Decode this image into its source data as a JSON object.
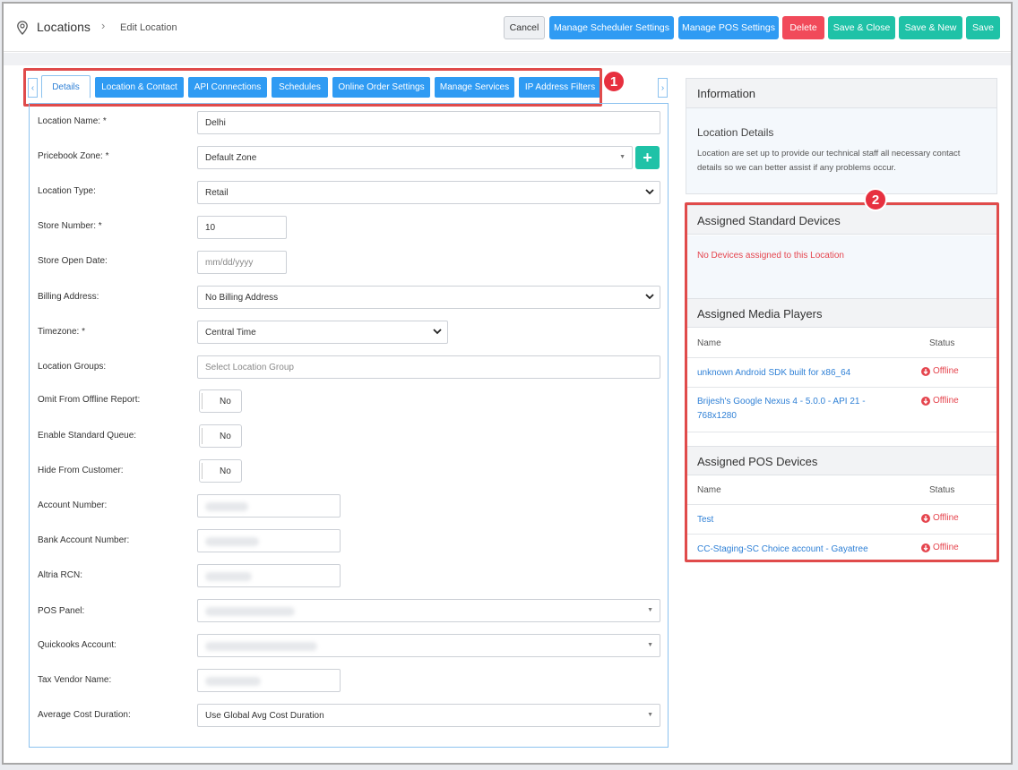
{
  "header": {
    "breadcrumb_main": "Locations",
    "breadcrumb_sep": "›",
    "breadcrumb_sub": "Edit Location",
    "buttons": {
      "cancel": "Cancel",
      "scheduler": "Manage Scheduler Settings",
      "pos": "Manage POS Settings",
      "delete": "Delete",
      "save_close": "Save & Close",
      "save_new": "Save & New",
      "save": "Save"
    }
  },
  "tabs": {
    "details": "Details",
    "location_contact": "Location & Contact",
    "api": "API Connections",
    "schedules": "Schedules",
    "online_order": "Online Order Settings",
    "services": "Manage Services",
    "ip_filters": "IP Address Filters",
    "prev_arrow": "‹",
    "next_arrow": "›"
  },
  "badges": {
    "one": "1",
    "two": "2"
  },
  "form": {
    "location_name": {
      "label": "Location Name: *",
      "value": "Delhi"
    },
    "pricebook_zone": {
      "label": "Pricebook Zone: *",
      "value": "Default Zone",
      "add": "+"
    },
    "location_type": {
      "label": "Location Type:",
      "value": "Retail"
    },
    "store_number": {
      "label": "Store Number: *",
      "value": "10"
    },
    "store_open_date": {
      "label": "Store Open Date:",
      "placeholder": "mm/dd/yyyy"
    },
    "billing_address": {
      "label": "Billing Address:",
      "value": "No Billing Address"
    },
    "timezone": {
      "label": "Timezone: *",
      "value": "Central Time"
    },
    "location_groups": {
      "label": "Location Groups:",
      "placeholder": "Select Location Group"
    },
    "omit_offline": {
      "label": "Omit From Offline Report:",
      "value": "No"
    },
    "standard_queue": {
      "label": "Enable Standard Queue:",
      "value": "No"
    },
    "hide_customer": {
      "label": "Hide From Customer:",
      "value": "No"
    },
    "account_number": {
      "label": "Account Number:"
    },
    "bank_account": {
      "label": "Bank Account Number:"
    },
    "altria_rcn": {
      "label": "Altria RCN:"
    },
    "pos_panel": {
      "label": "POS Panel:"
    },
    "quickbooks": {
      "label": "Quickooks Account:"
    },
    "tax_vendor": {
      "label": "Tax Vendor Name:"
    },
    "avg_cost": {
      "label": "Average Cost Duration:",
      "value": "Use Global Avg Cost Duration"
    }
  },
  "info": {
    "title": "Information",
    "subtitle": "Location Details",
    "description": "Location are set up to provide our technical staff all necessary contact details so we can better assist if any problems occur."
  },
  "standard_devices": {
    "title": "Assigned Standard Devices",
    "empty": "No Devices assigned to this Location"
  },
  "media_players": {
    "title": "Assigned Media Players",
    "col_name": "Name",
    "col_status": "Status",
    "rows": [
      {
        "name": "unknown Android SDK built for x86_64",
        "status": "Offline"
      },
      {
        "name": "Brijesh's Google Nexus 4 - 5.0.0 - API 21 - 768x1280",
        "status": "Offline"
      }
    ]
  },
  "pos_devices": {
    "title": "Assigned POS Devices",
    "col_name": "Name",
    "col_status": "Status",
    "rows": [
      {
        "name": "Test",
        "status": "Offline"
      },
      {
        "name": "CC-Staging-SC Choice account - Gayatree",
        "status": "Offline"
      }
    ]
  },
  "colors": {
    "primary_blue": "#2f9bf3",
    "danger_red": "#f14a5a",
    "teal": "#1fc2a7",
    "annotation_red": "#e04b4b"
  },
  "icons": {
    "location": "location-pin-icon",
    "offline": "offline-down-icon",
    "dropdown": "chevron-down-icon"
  }
}
